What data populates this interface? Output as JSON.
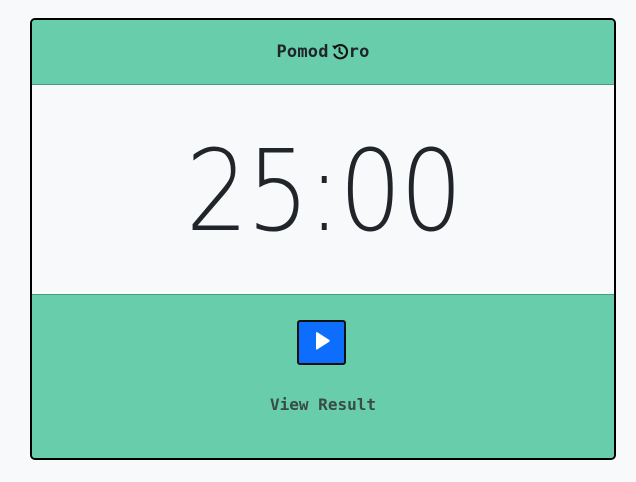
{
  "app": {
    "title_before_icon": "Pomod",
    "title_after_icon": "ro",
    "title_icon": "clock-history-icon"
  },
  "timer": {
    "display": "25:00"
  },
  "controls": {
    "play_icon": "play-icon"
  },
  "links": {
    "view_result_label": "View Result"
  },
  "colors": {
    "panel_green": "#67cdaa",
    "button_blue": "#0d6efd",
    "background": "#f8f9fa",
    "text_dark": "#212529"
  }
}
